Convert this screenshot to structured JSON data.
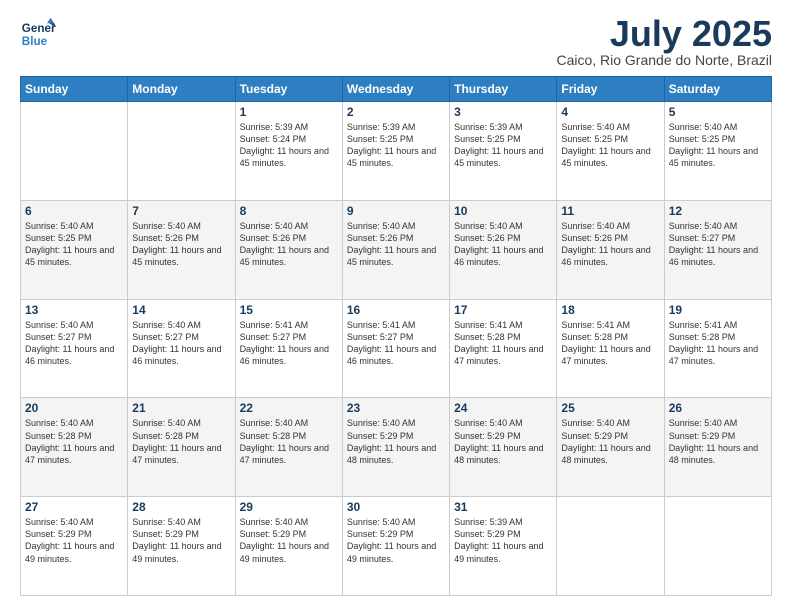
{
  "logo": {
    "line1": "General",
    "line2": "Blue"
  },
  "header": {
    "month": "July 2025",
    "location": "Caico, Rio Grande do Norte, Brazil"
  },
  "days_of_week": [
    "Sunday",
    "Monday",
    "Tuesday",
    "Wednesday",
    "Thursday",
    "Friday",
    "Saturday"
  ],
  "weeks": [
    [
      {
        "day": "",
        "info": ""
      },
      {
        "day": "",
        "info": ""
      },
      {
        "day": "1",
        "info": "Sunrise: 5:39 AM\nSunset: 5:24 PM\nDaylight: 11 hours and 45 minutes."
      },
      {
        "day": "2",
        "info": "Sunrise: 5:39 AM\nSunset: 5:25 PM\nDaylight: 11 hours and 45 minutes."
      },
      {
        "day": "3",
        "info": "Sunrise: 5:39 AM\nSunset: 5:25 PM\nDaylight: 11 hours and 45 minutes."
      },
      {
        "day": "4",
        "info": "Sunrise: 5:40 AM\nSunset: 5:25 PM\nDaylight: 11 hours and 45 minutes."
      },
      {
        "day": "5",
        "info": "Sunrise: 5:40 AM\nSunset: 5:25 PM\nDaylight: 11 hours and 45 minutes."
      }
    ],
    [
      {
        "day": "6",
        "info": "Sunrise: 5:40 AM\nSunset: 5:25 PM\nDaylight: 11 hours and 45 minutes."
      },
      {
        "day": "7",
        "info": "Sunrise: 5:40 AM\nSunset: 5:26 PM\nDaylight: 11 hours and 45 minutes."
      },
      {
        "day": "8",
        "info": "Sunrise: 5:40 AM\nSunset: 5:26 PM\nDaylight: 11 hours and 45 minutes."
      },
      {
        "day": "9",
        "info": "Sunrise: 5:40 AM\nSunset: 5:26 PM\nDaylight: 11 hours and 45 minutes."
      },
      {
        "day": "10",
        "info": "Sunrise: 5:40 AM\nSunset: 5:26 PM\nDaylight: 11 hours and 46 minutes."
      },
      {
        "day": "11",
        "info": "Sunrise: 5:40 AM\nSunset: 5:26 PM\nDaylight: 11 hours and 46 minutes."
      },
      {
        "day": "12",
        "info": "Sunrise: 5:40 AM\nSunset: 5:27 PM\nDaylight: 11 hours and 46 minutes."
      }
    ],
    [
      {
        "day": "13",
        "info": "Sunrise: 5:40 AM\nSunset: 5:27 PM\nDaylight: 11 hours and 46 minutes."
      },
      {
        "day": "14",
        "info": "Sunrise: 5:40 AM\nSunset: 5:27 PM\nDaylight: 11 hours and 46 minutes."
      },
      {
        "day": "15",
        "info": "Sunrise: 5:41 AM\nSunset: 5:27 PM\nDaylight: 11 hours and 46 minutes."
      },
      {
        "day": "16",
        "info": "Sunrise: 5:41 AM\nSunset: 5:27 PM\nDaylight: 11 hours and 46 minutes."
      },
      {
        "day": "17",
        "info": "Sunrise: 5:41 AM\nSunset: 5:28 PM\nDaylight: 11 hours and 47 minutes."
      },
      {
        "day": "18",
        "info": "Sunrise: 5:41 AM\nSunset: 5:28 PM\nDaylight: 11 hours and 47 minutes."
      },
      {
        "day": "19",
        "info": "Sunrise: 5:41 AM\nSunset: 5:28 PM\nDaylight: 11 hours and 47 minutes."
      }
    ],
    [
      {
        "day": "20",
        "info": "Sunrise: 5:40 AM\nSunset: 5:28 PM\nDaylight: 11 hours and 47 minutes."
      },
      {
        "day": "21",
        "info": "Sunrise: 5:40 AM\nSunset: 5:28 PM\nDaylight: 11 hours and 47 minutes."
      },
      {
        "day": "22",
        "info": "Sunrise: 5:40 AM\nSunset: 5:28 PM\nDaylight: 11 hours and 47 minutes."
      },
      {
        "day": "23",
        "info": "Sunrise: 5:40 AM\nSunset: 5:29 PM\nDaylight: 11 hours and 48 minutes."
      },
      {
        "day": "24",
        "info": "Sunrise: 5:40 AM\nSunset: 5:29 PM\nDaylight: 11 hours and 48 minutes."
      },
      {
        "day": "25",
        "info": "Sunrise: 5:40 AM\nSunset: 5:29 PM\nDaylight: 11 hours and 48 minutes."
      },
      {
        "day": "26",
        "info": "Sunrise: 5:40 AM\nSunset: 5:29 PM\nDaylight: 11 hours and 48 minutes."
      }
    ],
    [
      {
        "day": "27",
        "info": "Sunrise: 5:40 AM\nSunset: 5:29 PM\nDaylight: 11 hours and 49 minutes."
      },
      {
        "day": "28",
        "info": "Sunrise: 5:40 AM\nSunset: 5:29 PM\nDaylight: 11 hours and 49 minutes."
      },
      {
        "day": "29",
        "info": "Sunrise: 5:40 AM\nSunset: 5:29 PM\nDaylight: 11 hours and 49 minutes."
      },
      {
        "day": "30",
        "info": "Sunrise: 5:40 AM\nSunset: 5:29 PM\nDaylight: 11 hours and 49 minutes."
      },
      {
        "day": "31",
        "info": "Sunrise: 5:39 AM\nSunset: 5:29 PM\nDaylight: 11 hours and 49 minutes."
      },
      {
        "day": "",
        "info": ""
      },
      {
        "day": "",
        "info": ""
      }
    ]
  ]
}
